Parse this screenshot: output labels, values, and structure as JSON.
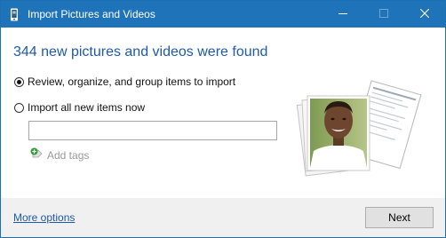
{
  "window": {
    "title": "Import Pictures and Videos",
    "icon": "camera-phone-icon"
  },
  "heading": "344 new pictures and videos were found",
  "options": [
    {
      "label": "Review, organize, and group items to import",
      "selected": true
    },
    {
      "label": "Import all new items now",
      "selected": false
    }
  ],
  "tags": {
    "value": "",
    "placeholder": "",
    "add_label": "Add tags",
    "icon": "add-tag-icon"
  },
  "footer": {
    "more_options_label": "More options",
    "next_label": "Next"
  },
  "colors": {
    "titlebar": "#1f73b8",
    "heading": "#1e5aa8",
    "link": "#1e5aa8",
    "footer_bg": "#f0f0f0"
  }
}
